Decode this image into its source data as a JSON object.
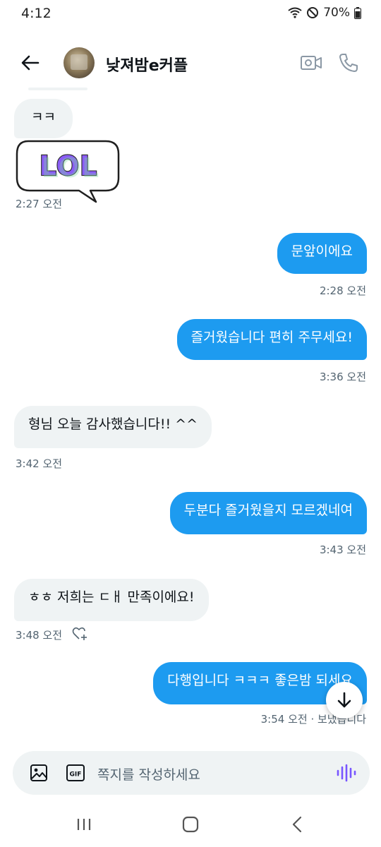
{
  "status_bar": {
    "time": "4:12",
    "battery": "70%"
  },
  "header": {
    "title": "낮져밤e커플"
  },
  "messages": [
    {
      "text": "ㅋㅋ",
      "side": "received"
    },
    {
      "text": "LOL",
      "sticker": true
    },
    {
      "meta": "2:27 오전"
    },
    {
      "text": "문앞이에요",
      "side": "sent",
      "meta": "2:28 오전"
    },
    {
      "text": "즐거웠습니다  편히 주무세요!",
      "side": "sent",
      "meta": "3:36 오전"
    },
    {
      "text": "형님 오늘 감사했습니다!! ^^",
      "side": "received",
      "meta": "3:42 오전"
    },
    {
      "text": "두분다 즐거웠을지 모르겠네여",
      "side": "sent",
      "meta": "3:43 오전"
    },
    {
      "text": "ㅎㅎ 저희는 ㄷㅐ 만족이에요!",
      "side": "received",
      "meta": "3:48 오전"
    },
    {
      "text": "다행입니다 ㅋㅋㅋ  좋은밤 되세요",
      "side": "sent",
      "meta": "3:54 오전 · 보냈습니다"
    }
  ],
  "composer": {
    "placeholder": "쪽지를 작성하세요",
    "gif_label": "GIF"
  },
  "colors": {
    "accent": "#1d9bf0",
    "received_bubble": "#eff3f4",
    "meta_text": "#536471",
    "voice": "#7856ff"
  },
  "icons": [
    "back-arrow-icon",
    "video-call-icon",
    "phone-icon",
    "image-icon",
    "gif-icon",
    "voice-wave-icon",
    "heart-add-icon",
    "arrow-down-icon",
    "wifi-icon",
    "do-not-disturb-icon",
    "battery-icon"
  ]
}
